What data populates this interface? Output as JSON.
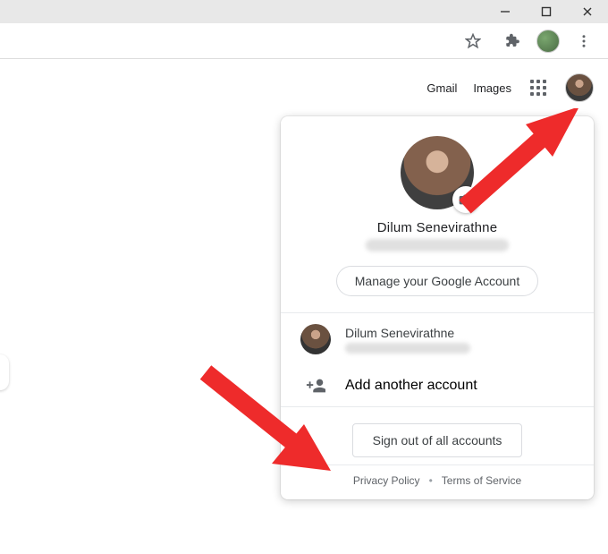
{
  "window": {
    "minimize": "−",
    "maximize": "☐",
    "close": "✕"
  },
  "toolbar": {
    "star": "star-icon",
    "extensions": "extensions-icon",
    "more": "more-icon"
  },
  "topnav": {
    "gmail": "Gmail",
    "images": "Images"
  },
  "account_menu": {
    "name": "Dilum Senevirathne",
    "manage_label": "Manage your Google Account",
    "other_accounts": [
      {
        "name": "Dilum Senevirathne"
      }
    ],
    "add_account_label": "Add another account",
    "signout_label": "Sign out of all accounts",
    "footer": {
      "privacy": "Privacy Policy",
      "terms": "Terms of Service"
    }
  },
  "annotations": {
    "arrow1_target": "profile-avatar",
    "arrow2_target": "signout-button"
  }
}
